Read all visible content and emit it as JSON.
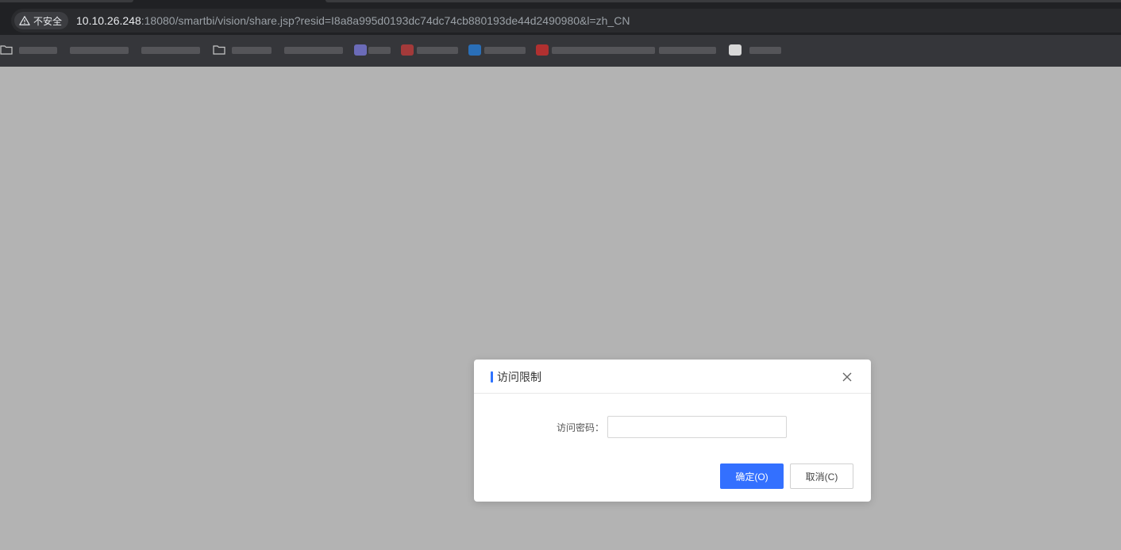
{
  "browser": {
    "security_label": "不安全",
    "url_host": "10.10.26.248",
    "url_rest": ":18080/smartbi/vision/share.jsp?resid=I8a8a995d0193dc74dc74cb880193de44d2490980&l=zh_CN"
  },
  "dialog": {
    "title": "访问限制",
    "field_label": "访问密码：",
    "password_value": "",
    "ok_label": "确定(O)",
    "cancel_label": "取消(C)"
  },
  "colors": {
    "accent": "#3370ff",
    "overlay": "#b3b3b3"
  }
}
